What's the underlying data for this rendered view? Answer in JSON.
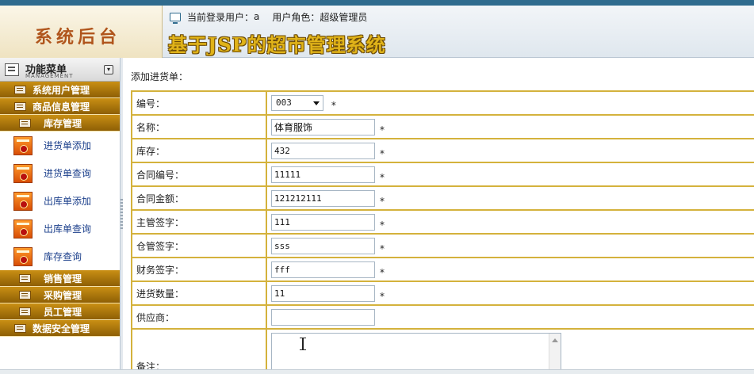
{
  "header": {
    "logo": "系统后台",
    "current_user_label": "当前登录用户：",
    "current_user": "a",
    "role_label": "用户角色：",
    "role": "超级管理员",
    "system_title": "基于JSP的超市管理系统"
  },
  "sidebar": {
    "title": "功能菜单",
    "subtitle": "MANAGEMENT",
    "toggle_icon": "collapse-icon",
    "categories_top": [
      {
        "label": "系统用户管理"
      },
      {
        "label": "商品信息管理"
      },
      {
        "label": "库存管理"
      }
    ],
    "sub_items": [
      {
        "label": "进货单添加"
      },
      {
        "label": "进货单查询"
      },
      {
        "label": "出库单添加"
      },
      {
        "label": "出库单查询"
      },
      {
        "label": "库存查询"
      }
    ],
    "categories_bottom": [
      {
        "label": "销售管理"
      },
      {
        "label": "采购管理"
      },
      {
        "label": "员工管理"
      },
      {
        "label": "数据安全管理"
      }
    ]
  },
  "form": {
    "caption": "添加进货单：",
    "required_mark": "*",
    "fields": [
      {
        "label": "编号：",
        "value": "003",
        "type": "select"
      },
      {
        "label": "名称：",
        "value": "体育服饰"
      },
      {
        "label": "库存：",
        "value": "432"
      },
      {
        "label": "合同编号：",
        "value": "11111"
      },
      {
        "label": "合同金额：",
        "value": "121212111"
      },
      {
        "label": "主管签字：",
        "value": "111"
      },
      {
        "label": "仓管签字：",
        "value": "sss"
      },
      {
        "label": "财务签字：",
        "value": "fff"
      },
      {
        "label": "进货数量：",
        "value": "11"
      },
      {
        "label": "供应商：",
        "value": ""
      },
      {
        "label": "备注：",
        "value": ""
      }
    ]
  },
  "colors": {
    "menu_category": "#b07a0c",
    "table_border": "#d4b23c",
    "title_gold": "#e0b319",
    "link_blue": "#1b3f8b"
  }
}
